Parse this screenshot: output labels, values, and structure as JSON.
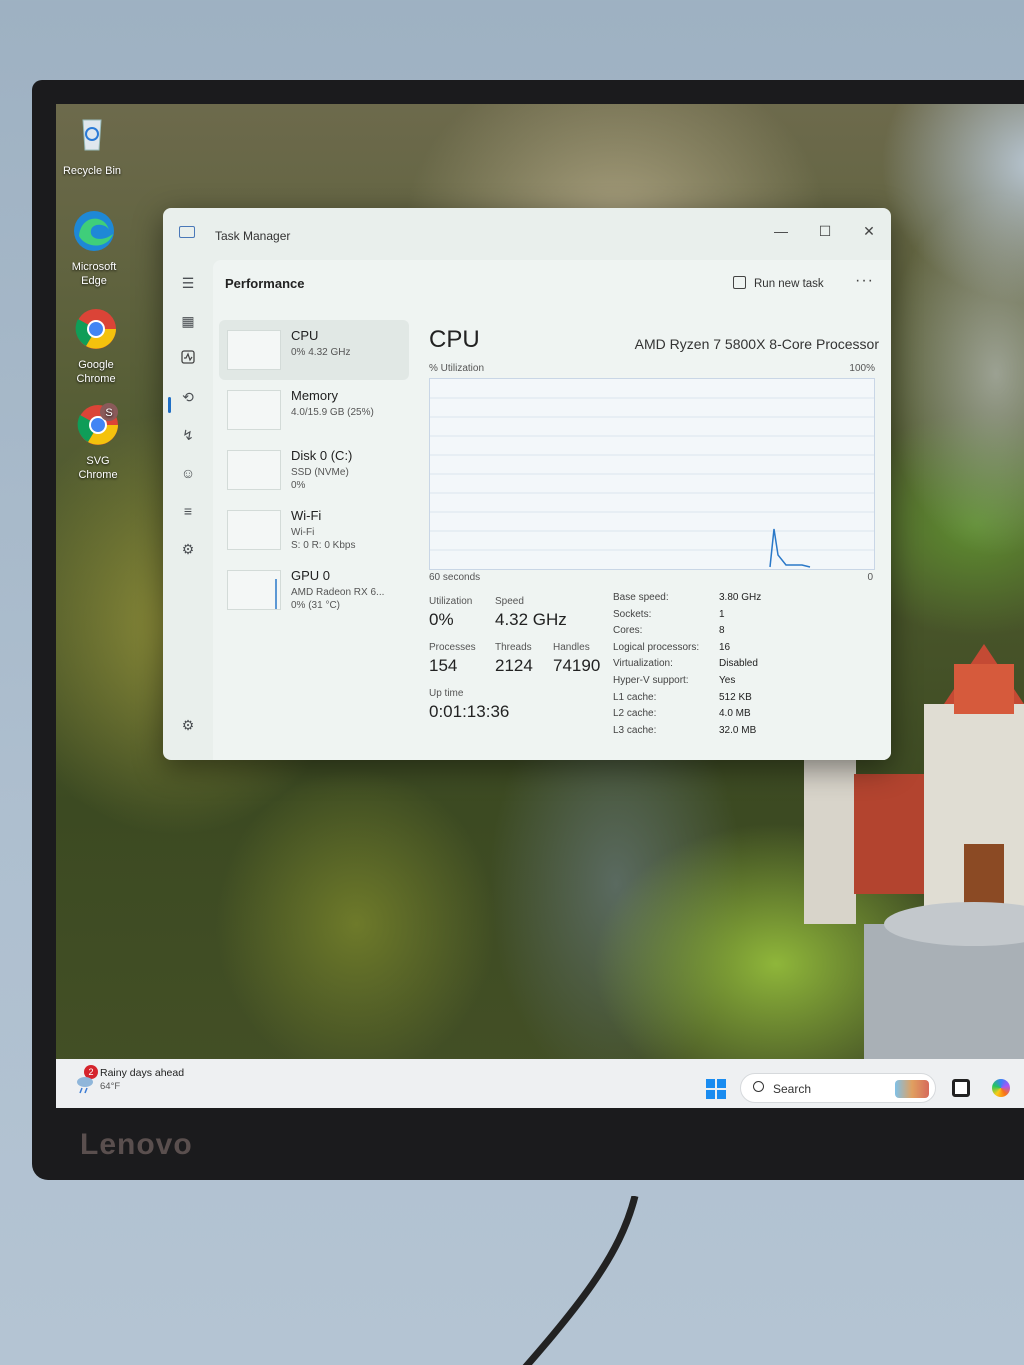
{
  "monitor": {
    "brand": "Lenovo"
  },
  "desktop": {
    "icons": [
      {
        "label": "Recycle Bin",
        "icon": "recycle-bin-icon"
      },
      {
        "label": "Microsoft Edge",
        "icon": "edge-icon"
      },
      {
        "label": "Google Chrome",
        "icon": "chrome-icon"
      },
      {
        "label": "SVG Chrome",
        "icon": "chrome-profile-icon",
        "badge": "S"
      }
    ]
  },
  "taskmanager": {
    "window_title": "Task Manager",
    "window_buttons": {
      "minimize": "—",
      "maximize": "☐",
      "close": "✕"
    },
    "page_title": "Performance",
    "run_new_task": "Run new task",
    "more": "···",
    "devices": [
      {
        "name": "CPU",
        "sub": "0% 4.32 GHz",
        "selected": true
      },
      {
        "name": "Memory",
        "sub": "4.0/15.9 GB (25%)"
      },
      {
        "name": "Disk 0 (C:)",
        "sub": "SSD (NVMe)\n0%"
      },
      {
        "name": "Wi-Fi",
        "sub": "Wi-Fi\nS: 0 R: 0 Kbps"
      },
      {
        "name": "GPU 0",
        "sub": "AMD Radeon RX 6...\n0% (31 °C)"
      }
    ],
    "cpu": {
      "title": "CPU",
      "model": "AMD Ryzen 7 5800X 8-Core Processor",
      "util_label": "% Utilization",
      "util_max": "100%",
      "time_window": "60 seconds",
      "zero": "0",
      "stats": {
        "utilization_label": "Utilization",
        "utilization": "0%",
        "speed_label": "Speed",
        "speed": "4.32 GHz",
        "processes_label": "Processes",
        "processes": "154",
        "threads_label": "Threads",
        "threads": "2124",
        "handles_label": "Handles",
        "handles": "74190",
        "uptime_label": "Up time",
        "uptime": "0:01:13:36"
      },
      "specs": [
        {
          "k": "Base speed:",
          "v": "3.80 GHz"
        },
        {
          "k": "Sockets:",
          "v": "1"
        },
        {
          "k": "Cores:",
          "v": "8"
        },
        {
          "k": "Logical processors:",
          "v": "16"
        },
        {
          "k": "Virtualization:",
          "v": "Disabled"
        },
        {
          "k": "Hyper-V support:",
          "v": "Yes"
        },
        {
          "k": "L1 cache:",
          "v": "512 KB"
        },
        {
          "k": "L2 cache:",
          "v": "4.0 MB"
        },
        {
          "k": "L3 cache:",
          "v": "32.0 MB"
        }
      ]
    },
    "colors": {
      "accent": "#1f6fc5",
      "graph_line": "#2a78c8"
    }
  },
  "taskbar": {
    "weather_badge": "2",
    "weather_text": "Rainy days ahead",
    "weather_temp": "64°F",
    "search_placeholder": "Search"
  }
}
